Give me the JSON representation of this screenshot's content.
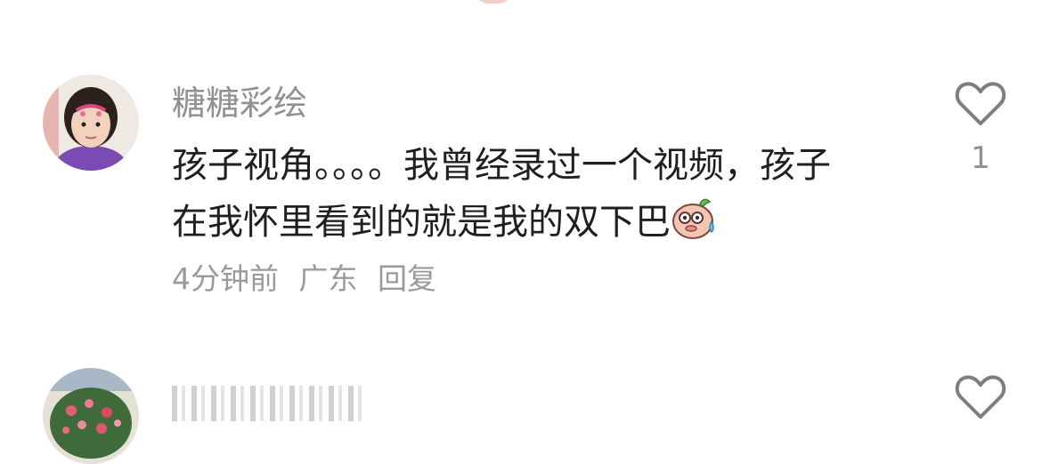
{
  "comments": [
    {
      "username": "糖糖彩绘",
      "text_line1": "孩子视角。。。。我曾经录过一个视频，孩子",
      "text_line2": "在我怀里看到的就是我的双下巴",
      "emoji": "sweat-pig-emoji",
      "time": "4分钟前",
      "location": "广东",
      "reply_label": "回复",
      "like_count": "1",
      "like_icon": "heart-outline-icon"
    },
    {
      "like_icon": "heart-outline-icon"
    }
  ],
  "colors": {
    "username": "#8f8f94",
    "text": "#1f1f1f",
    "meta": "#9a9a9e",
    "icon": "#7d7d82"
  }
}
